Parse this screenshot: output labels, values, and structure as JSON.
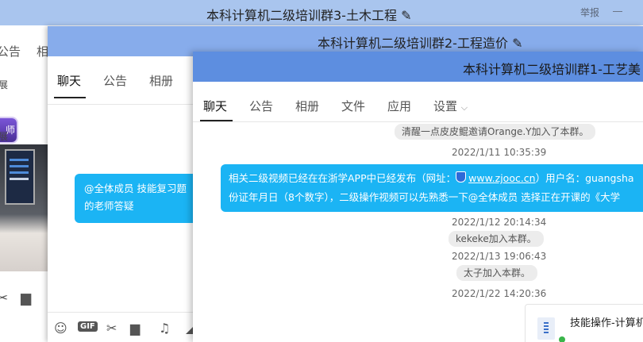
{
  "window3": {
    "title": "本科计算机二级培训群3-土木工程",
    "report": "举报",
    "tabs": [
      "公告",
      "相"
    ],
    "side_texts": [
      "展",
      "展"
    ],
    "badge": "师"
  },
  "window2": {
    "title": "本科计算机二级培训群2-工程造价",
    "tabs": [
      "聊天",
      "公告",
      "相册"
    ],
    "bubble_line1": "@全体成员    技能复习题",
    "bubble_line2": "的老师答疑",
    "toolbar_gif": "GIF"
  },
  "window1": {
    "title": "本科计算机二级培训群1-工艺美",
    "tabs": [
      "聊天",
      "公告",
      "相册",
      "文件",
      "应用",
      "设置"
    ],
    "messages": [
      {
        "system": "清醒一点皮皮鲲邀请Orange.Y加入了本群。"
      },
      {
        "time": "2022/1/11 10:35:39"
      },
      {
        "line1_prefix": "相关二级视频已经在在浙学APP中已经发布（网址：",
        "link": "www.zjooc.cn",
        "line1_suffix": "）用户名：guangsha",
        "line2": "份证年月日（8个数字），二级操作视频可以先熟悉一下@全体成员    选择正在开课的《大学"
      },
      {
        "time": "2022/1/12 20:14:34"
      },
      {
        "system": "kekeke加入本群。"
      },
      {
        "time": "2022/1/13 19:06:43"
      },
      {
        "system": "太子加入本群。"
      },
      {
        "time": "2022/1/22 14:20:36"
      }
    ],
    "file_name": "技能操作-计算机"
  },
  "colors": {
    "title3_bg": "#a9c5ee",
    "title2_bg": "#87aceb",
    "title1_bg": "#5d8ee0",
    "bubble": "#1bb4f4"
  }
}
